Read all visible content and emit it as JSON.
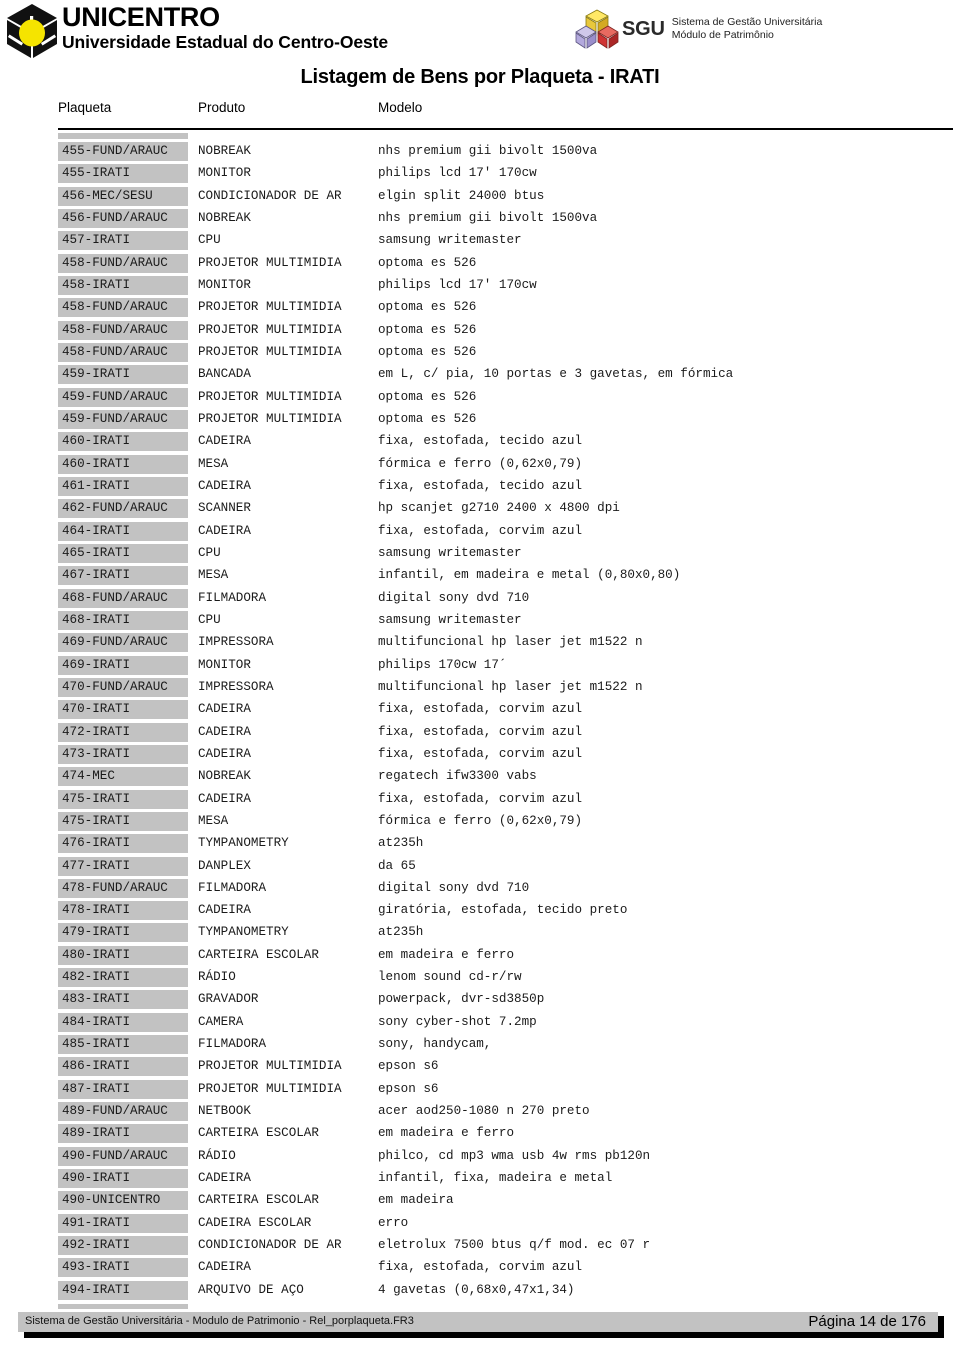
{
  "header": {
    "university_name": "UNICENTRO",
    "university_subtitle": "Universidade Estadual do Centro-Oeste",
    "unicentro_logo_icon": "unicentro-cube-logo",
    "sgu_logo_icon": "sgu-cubes-logo",
    "sgu_acronym": "SGU",
    "sgu_line1": "Sistema de Gestão Universitária",
    "sgu_line2": "Módulo de Patrimônio"
  },
  "report": {
    "title": "Listagem de Bens por Plaqueta - IRATI"
  },
  "table": {
    "columns": [
      "Plaqueta",
      "Produto",
      "Modelo"
    ],
    "rows": [
      {
        "plaqueta": "455-FUND/ARAUC",
        "produto": "NOBREAK",
        "modelo": "nhs premium gii bivolt 1500va"
      },
      {
        "plaqueta": "455-IRATI",
        "produto": "MONITOR",
        "modelo": "philips lcd 17' 170cw"
      },
      {
        "plaqueta": "456-MEC/SESU",
        "produto": "CONDICIONADOR DE AR",
        "modelo": "elgin split 24000 btus"
      },
      {
        "plaqueta": "456-FUND/ARAUC",
        "produto": "NOBREAK",
        "modelo": "nhs premium gii bivolt 1500va"
      },
      {
        "plaqueta": "457-IRATI",
        "produto": "CPU",
        "modelo": "samsung writemaster"
      },
      {
        "plaqueta": "458-FUND/ARAUC",
        "produto": "PROJETOR MULTIMIDIA",
        "modelo": "optoma es 526"
      },
      {
        "plaqueta": "458-IRATI",
        "produto": "MONITOR",
        "modelo": "philips lcd 17' 170cw"
      },
      {
        "plaqueta": "458-FUND/ARAUC",
        "produto": "PROJETOR MULTIMIDIA",
        "modelo": "optoma es 526"
      },
      {
        "plaqueta": "458-FUND/ARAUC",
        "produto": "PROJETOR MULTIMIDIA",
        "modelo": "optoma es 526"
      },
      {
        "plaqueta": "458-FUND/ARAUC",
        "produto": "PROJETOR MULTIMIDIA",
        "modelo": "optoma es 526"
      },
      {
        "plaqueta": "459-IRATI",
        "produto": "BANCADA",
        "modelo": "em L, c/ pia, 10 portas e 3 gavetas, em fórmica"
      },
      {
        "plaqueta": "459-FUND/ARAUC",
        "produto": "PROJETOR MULTIMIDIA",
        "modelo": "optoma es 526"
      },
      {
        "plaqueta": "459-FUND/ARAUC",
        "produto": "PROJETOR MULTIMIDIA",
        "modelo": "optoma es 526"
      },
      {
        "plaqueta": "460-IRATI",
        "produto": "CADEIRA",
        "modelo": "fixa, estofada, tecido azul"
      },
      {
        "plaqueta": "460-IRATI",
        "produto": "MESA",
        "modelo": "fórmica e ferro (0,62x0,79)"
      },
      {
        "plaqueta": "461-IRATI",
        "produto": "CADEIRA",
        "modelo": "fixa, estofada, tecido azul"
      },
      {
        "plaqueta": "462-FUND/ARAUC",
        "produto": "SCANNER",
        "modelo": "hp scanjet g2710 2400 x 4800 dpi"
      },
      {
        "plaqueta": "464-IRATI",
        "produto": "CADEIRA",
        "modelo": "fixa, estofada, corvim azul"
      },
      {
        "plaqueta": "465-IRATI",
        "produto": "CPU",
        "modelo": "samsung writemaster"
      },
      {
        "plaqueta": "467-IRATI",
        "produto": "MESA",
        "modelo": "infantil, em madeira e metal (0,80x0,80)"
      },
      {
        "plaqueta": "468-FUND/ARAUC",
        "produto": "FILMADORA",
        "modelo": "digital sony dvd 710"
      },
      {
        "plaqueta": "468-IRATI",
        "produto": "CPU",
        "modelo": "samsung writemaster"
      },
      {
        "plaqueta": "469-FUND/ARAUC",
        "produto": "IMPRESSORA",
        "modelo": "multifuncional hp laser jet m1522 n"
      },
      {
        "plaqueta": "469-IRATI",
        "produto": "MONITOR",
        "modelo": "philips 170cw 17´"
      },
      {
        "plaqueta": "470-FUND/ARAUC",
        "produto": "IMPRESSORA",
        "modelo": "multifuncional hp laser jet m1522 n"
      },
      {
        "plaqueta": "470-IRATI",
        "produto": "CADEIRA",
        "modelo": "fixa, estofada, corvim azul"
      },
      {
        "plaqueta": "472-IRATI",
        "produto": "CADEIRA",
        "modelo": "fixa, estofada, corvim azul"
      },
      {
        "plaqueta": "473-IRATI",
        "produto": "CADEIRA",
        "modelo": "fixa, estofada, corvim azul"
      },
      {
        "plaqueta": "474-MEC",
        "produto": "NOBREAK",
        "modelo": "regatech ifw3300 vabs"
      },
      {
        "plaqueta": "475-IRATI",
        "produto": "CADEIRA",
        "modelo": "fixa, estofada, corvim azul"
      },
      {
        "plaqueta": "475-IRATI",
        "produto": "MESA",
        "modelo": "fórmica e ferro (0,62x0,79)"
      },
      {
        "plaqueta": "476-IRATI",
        "produto": "TYMPANOMETRY",
        "modelo": "at235h"
      },
      {
        "plaqueta": "477-IRATI",
        "produto": "DANPLEX",
        "modelo": "da 65"
      },
      {
        "plaqueta": "478-FUND/ARAUC",
        "produto": "FILMADORA",
        "modelo": "digital sony dvd 710"
      },
      {
        "plaqueta": "478-IRATI",
        "produto": "CADEIRA",
        "modelo": "giratória, estofada, tecido preto"
      },
      {
        "plaqueta": "479-IRATI",
        "produto": "TYMPANOMETRY",
        "modelo": "at235h"
      },
      {
        "plaqueta": "480-IRATI",
        "produto": "CARTEIRA ESCOLAR",
        "modelo": "em madeira e ferro"
      },
      {
        "plaqueta": "482-IRATI",
        "produto": "RÁDIO",
        "modelo": "lenom sound cd-r/rw"
      },
      {
        "plaqueta": "483-IRATI",
        "produto": "GRAVADOR",
        "modelo": "powerpack, dvr-sd3850p"
      },
      {
        "plaqueta": "484-IRATI",
        "produto": "CAMERA",
        "modelo": "sony cyber-shot 7.2mp"
      },
      {
        "plaqueta": "485-IRATI",
        "produto": "FILMADORA",
        "modelo": "sony, handycam,"
      },
      {
        "plaqueta": "486-IRATI",
        "produto": "PROJETOR MULTIMIDIA",
        "modelo": "epson s6"
      },
      {
        "plaqueta": "487-IRATI",
        "produto": "PROJETOR MULTIMIDIA",
        "modelo": "epson s6"
      },
      {
        "plaqueta": "489-FUND/ARAUC",
        "produto": "NETBOOK",
        "modelo": "acer aod250-1080 n 270 preto"
      },
      {
        "plaqueta": "489-IRATI",
        "produto": "CARTEIRA ESCOLAR",
        "modelo": "em madeira e ferro"
      },
      {
        "plaqueta": "490-FUND/ARAUC",
        "produto": "RÁDIO",
        "modelo": "philco, cd mp3 wma usb 4w rms pb120n"
      },
      {
        "plaqueta": "490-IRATI",
        "produto": "CADEIRA",
        "modelo": "infantil, fixa, madeira e metal"
      },
      {
        "plaqueta": "490-UNICENTRO",
        "produto": "CARTEIRA ESCOLAR",
        "modelo": "em madeira"
      },
      {
        "plaqueta": "491-IRATI",
        "produto": "CADEIRA ESCOLAR",
        "modelo": "erro"
      },
      {
        "plaqueta": "492-IRATI",
        "produto": "CONDICIONADOR DE AR",
        "modelo": "eletrolux 7500 btus q/f mod. ec 07 r"
      },
      {
        "plaqueta": "493-IRATI",
        "produto": "CADEIRA",
        "modelo": "fixa, estofada, corvim azul"
      },
      {
        "plaqueta": "494-IRATI",
        "produto": "ARQUIVO DE AÇO",
        "modelo": "4 gavetas (0,68x0,47x1,34)"
      }
    ]
  },
  "footer": {
    "left_text": "Sistema de Gestão Universitária - Modulo de Patrimonio - Rel_porplaqueta.FR3",
    "page_text": "Página 14 de 176"
  },
  "colors": {
    "row_gray": "#c2c2c2",
    "logo_yellow": "#f5e400",
    "logo_black": "#000000",
    "sgu_red": "#cf3333",
    "sgu_purple": "#a9a0d6"
  }
}
